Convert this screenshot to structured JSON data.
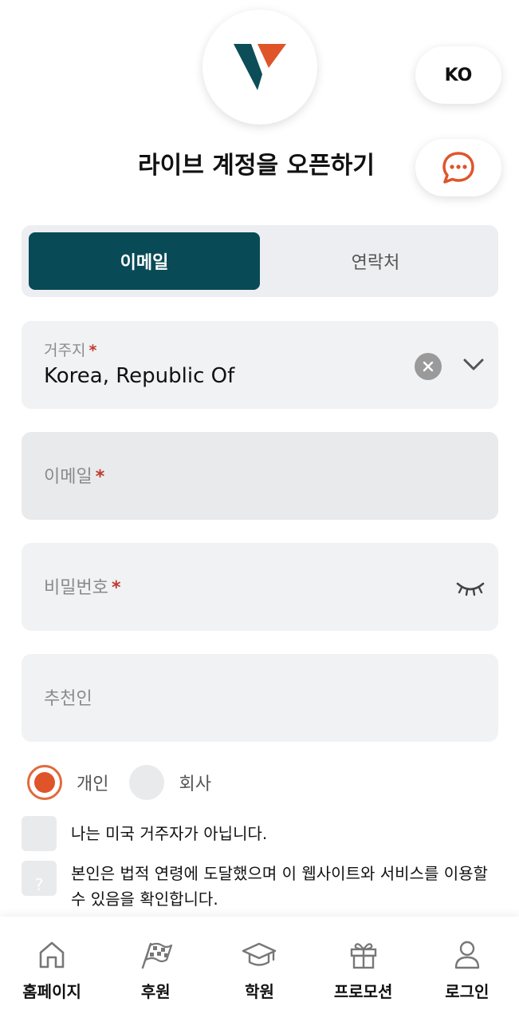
{
  "header": {
    "title": "라이브 계정을 오픈하기",
    "language": "KO"
  },
  "tabs": [
    {
      "label": "이메일",
      "active": true
    },
    {
      "label": "연락처",
      "active": false
    }
  ],
  "form": {
    "residence": {
      "label": "거주지",
      "required_mark": "*",
      "value": "Korea, Republic Of"
    },
    "email": {
      "label": "이메일",
      "required_mark": "*",
      "value": ""
    },
    "password": {
      "label": "비밀번호",
      "required_mark": "*",
      "value": ""
    },
    "referrer": {
      "label": "추천인",
      "value": ""
    }
  },
  "account_type": {
    "options": [
      {
        "label": "개인",
        "selected": true
      },
      {
        "label": "회사",
        "selected": false
      }
    ]
  },
  "checks": [
    {
      "text": "나는 미국 거주자가 아닙니다.",
      "checked": false
    },
    {
      "text": "본인은 법적 연령에 도달했으며 이 웹사이트와 서비스를 이용할 수 있음을 확인합니다.",
      "checked": false
    }
  ],
  "bottom_nav": [
    {
      "label": "홈페이지",
      "icon": "home-icon"
    },
    {
      "label": "후원",
      "icon": "checkered-flag-icon"
    },
    {
      "label": "학원",
      "icon": "graduation-cap-icon"
    },
    {
      "label": "프로모션",
      "icon": "gift-icon"
    },
    {
      "label": "로그인",
      "icon": "user-icon"
    }
  ],
  "colors": {
    "primary": "#094a57",
    "accent": "#e0542a",
    "required": "#c0392b"
  }
}
